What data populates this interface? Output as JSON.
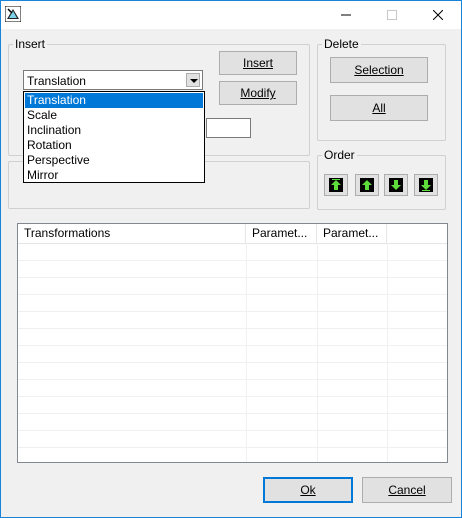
{
  "window": {
    "app_icon": "app-icon",
    "controls": {
      "minimize": "–",
      "maximize": "☐",
      "close": "✕"
    }
  },
  "insert_group": {
    "title": "Insert",
    "combo_value": "Translation",
    "options": [
      "Translation",
      "Scale",
      "Inclination",
      "Rotation",
      "Perspective",
      "Mirror"
    ],
    "selected_index": 0,
    "insert_button": "Insert",
    "modify_button": "Modify"
  },
  "delete_group": {
    "title": "Delete",
    "selection_button": "Selection",
    "all_button": "All"
  },
  "order_group": {
    "title": "Order",
    "buttons": [
      "move-top-icon",
      "move-up-icon",
      "move-down-icon",
      "move-bottom-icon"
    ]
  },
  "list": {
    "columns": [
      "Transformations",
      "Paramet...",
      "Paramet..."
    ]
  },
  "footer": {
    "ok_button": "Ok",
    "cancel_button": "Cancel"
  },
  "colors": {
    "accent": "#0078d7",
    "arrow_green": "#5ddc3c"
  }
}
